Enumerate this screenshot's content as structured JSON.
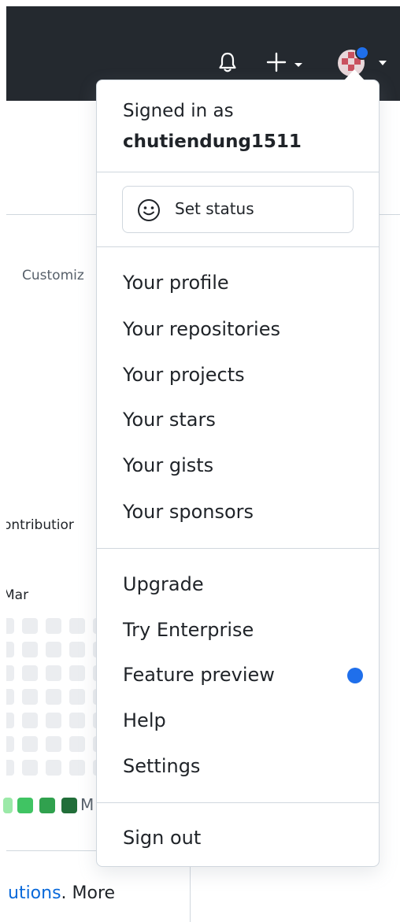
{
  "header": {
    "icons": [
      "bell-icon",
      "plus-icon",
      "caret-down-icon",
      "avatar"
    ],
    "colors": {
      "bg": "#24292f",
      "notification": "#1f6feb"
    }
  },
  "background": {
    "customize_text": "Customiz",
    "contributions_text": "ontributior",
    "month_label": "Mar",
    "legend_more_label": "M",
    "bottom_link_text": "utions",
    "bottom_text": ". More"
  },
  "menu": {
    "signed_in_label": "Signed in as",
    "username": "chutiendung1511",
    "set_status_label": "Set status",
    "group1": [
      "Your profile",
      "Your repositories",
      "Your projects",
      "Your stars",
      "Your gists",
      "Your sponsors"
    ],
    "group2": [
      "Upgrade",
      "Try Enterprise",
      "Feature preview",
      "Help",
      "Settings"
    ],
    "sign_out_label": "Sign out",
    "colors": {
      "accent_dot": "#1f6feb",
      "border": "#d0d7de"
    }
  }
}
